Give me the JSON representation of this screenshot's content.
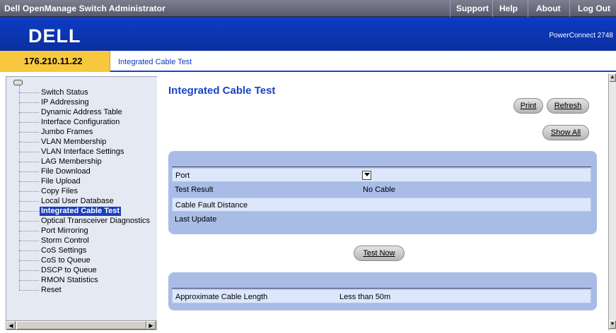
{
  "topbar": {
    "app_title": "Dell OpenManage Switch Administrator",
    "menu": [
      "Support",
      "Help",
      "About",
      "Log Out"
    ]
  },
  "brand": {
    "logo": "DELL",
    "product": "PowerConnect 2748"
  },
  "address": {
    "ip": "176.210.11.22",
    "breadcrumb": "Integrated Cable Test"
  },
  "nav": {
    "items": [
      "Switch Status",
      "IP Addressing",
      "Dynamic Address Table",
      "Interface Configuration",
      "Jumbo Frames",
      "VLAN Membership",
      "VLAN Interface Settings",
      "LAG Membership",
      "File Download",
      "File Upload",
      "Copy Files",
      "Local User Database",
      "Integrated Cable Test",
      "Optical Transceiver Diagnostics",
      "Port Mirroring",
      "Storm Control",
      "CoS Settings",
      "CoS to Queue",
      "DSCP to Queue",
      "RMON Statistics",
      "Reset"
    ],
    "active_index": 12
  },
  "page": {
    "title": "Integrated Cable Test",
    "print_label": "Print",
    "refresh_label": "Refresh",
    "show_all_label": "Show All",
    "test_now_label": "Test Now"
  },
  "test_table": {
    "port_label": "Port",
    "port_value": "",
    "test_result_label": "Test Result",
    "test_result_value": "No Cable",
    "fault_distance_label": "Cable Fault Distance",
    "fault_distance_value": "",
    "last_update_label": "Last Update",
    "last_update_value": ""
  },
  "length_table": {
    "label": "Approximate Cable Length",
    "value": "Less than 50m"
  },
  "colors": {
    "brand_blue": "#0d3cc4",
    "ip_box": "#f7c83d",
    "panel": "#a8bce6",
    "active_nav": "#1a3ebd"
  }
}
